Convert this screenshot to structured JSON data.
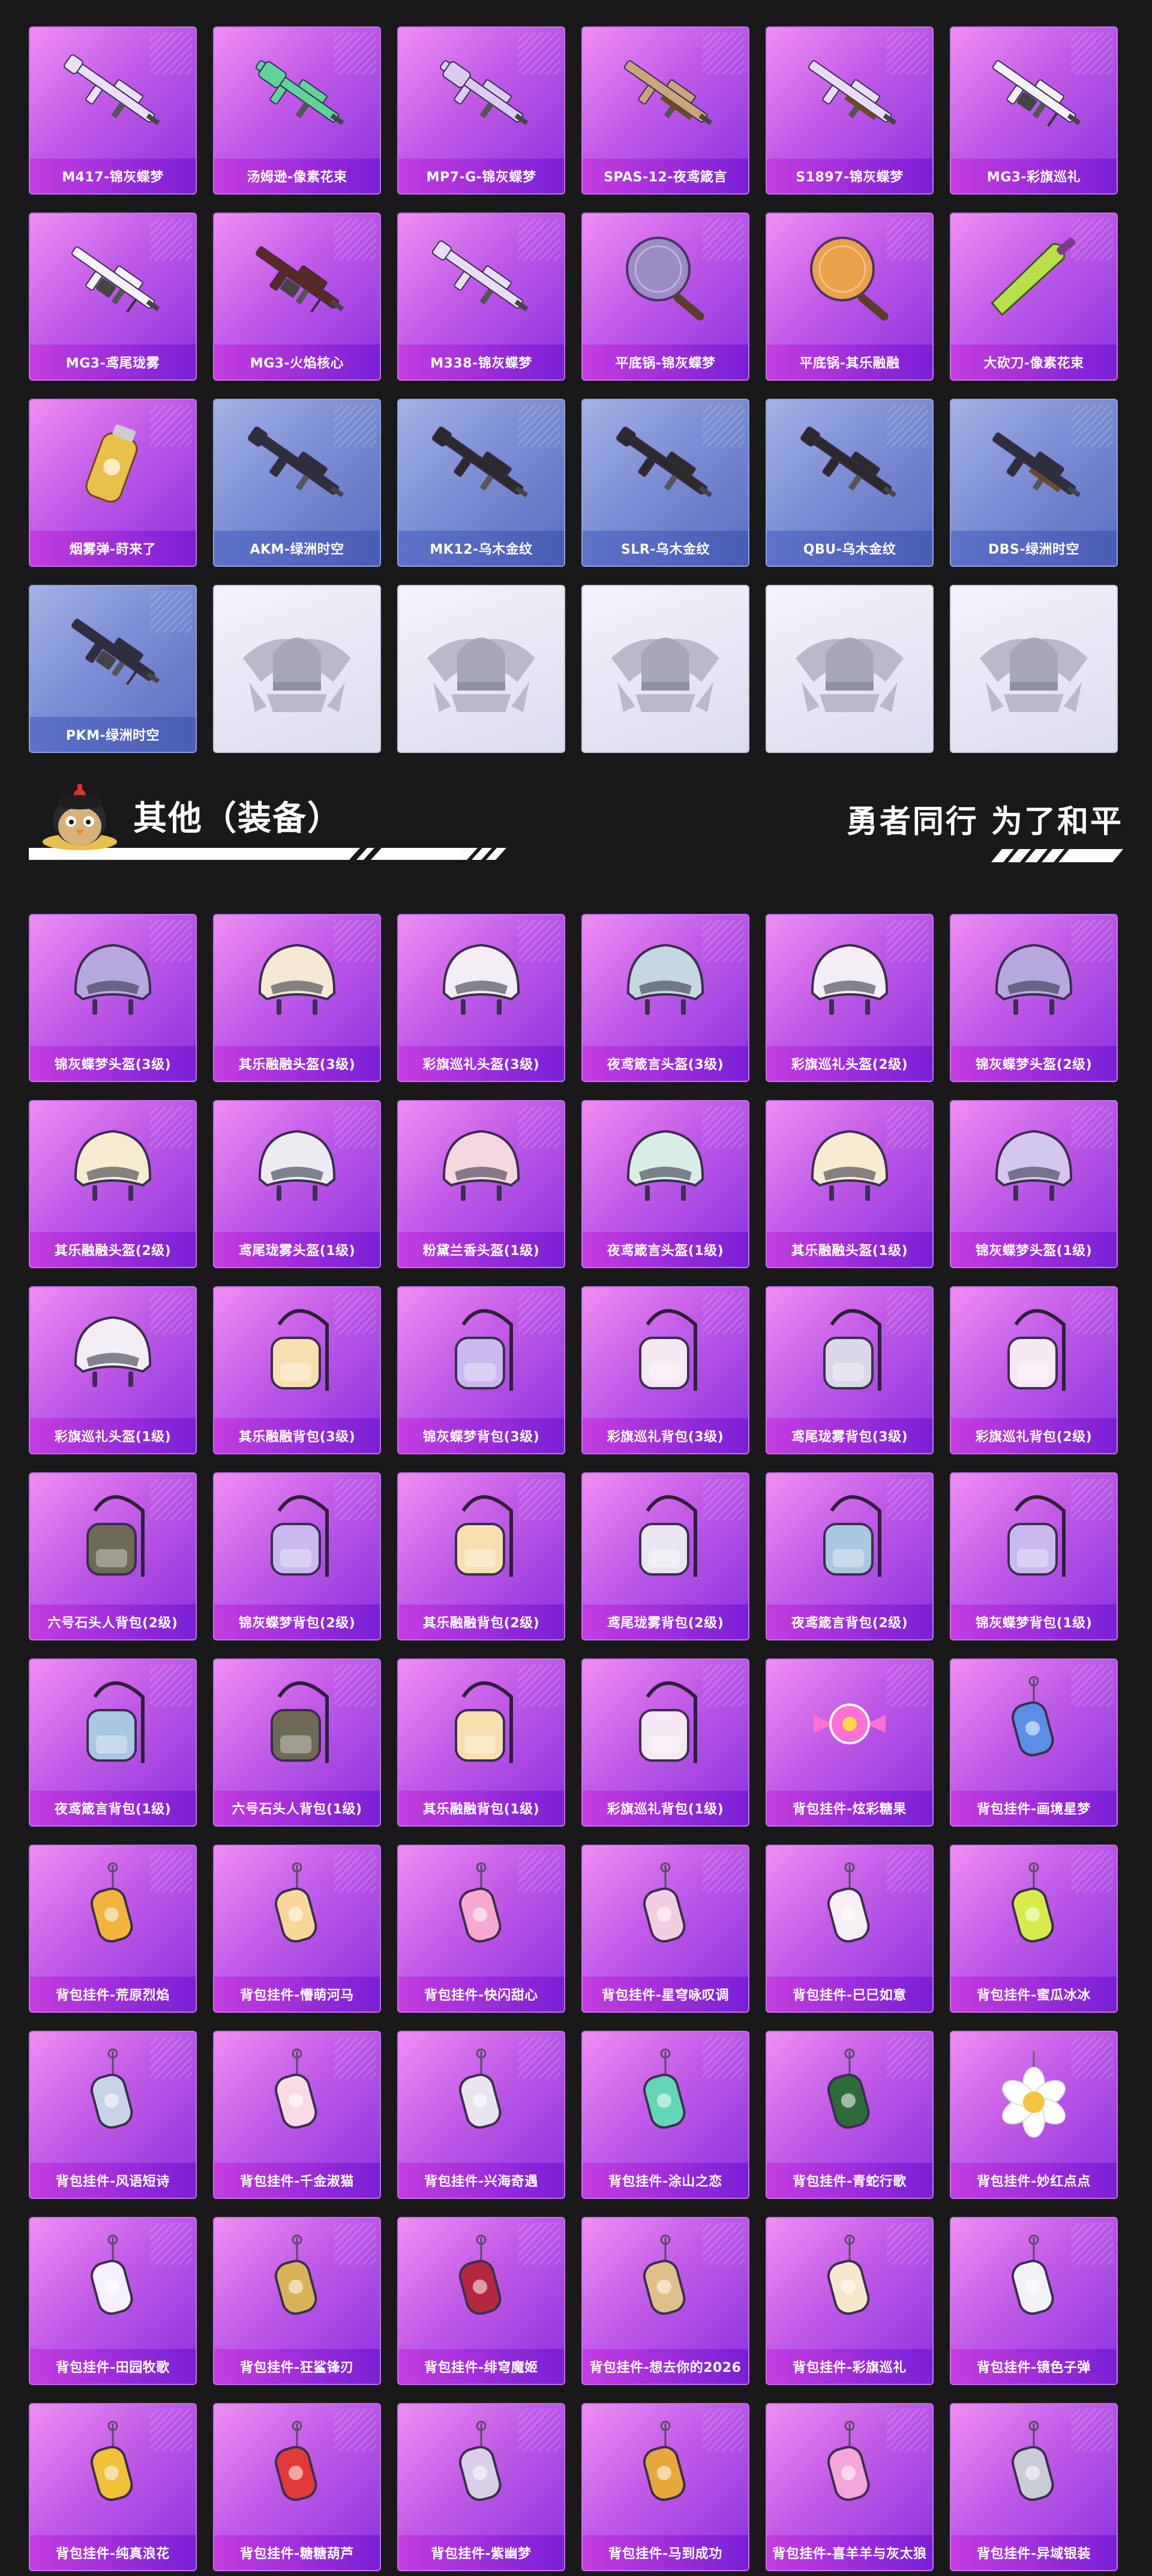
{
  "weapons": {
    "items": [
      {
        "label": "M417-锦灰蝶梦",
        "style": "purple",
        "icon": "rifle-icon",
        "color": "#e8e0f4"
      },
      {
        "label": "汤姆逊-像素花束",
        "style": "purple",
        "icon": "smg-icon",
        "color": "#5fd39a"
      },
      {
        "label": "MP7-G-锦灰蝶梦",
        "style": "purple",
        "icon": "smg-icon",
        "color": "#d8cdef"
      },
      {
        "label": "SPAS-12-夜鸢箴言",
        "style": "purple",
        "icon": "shotgun-icon",
        "color": "#c9a67a"
      },
      {
        "label": "S1897-锦灰蝶梦",
        "style": "purple",
        "icon": "shotgun-icon",
        "color": "#e6ddf2"
      },
      {
        "label": "MG3-彩旗巡礼",
        "style": "purple",
        "icon": "machinegun-icon",
        "color": "#f2f2f2"
      },
      {
        "label": "MG3-鸢尾珑雾",
        "style": "purple",
        "icon": "machinegun-icon",
        "color": "#f5f3f7"
      },
      {
        "label": "MG3-火焰核心",
        "style": "purple",
        "icon": "machinegun-icon",
        "color": "#5a2a22"
      },
      {
        "label": "M338-锦灰蝶梦",
        "style": "purple",
        "icon": "rifle-icon",
        "color": "#e6dff2"
      },
      {
        "label": "平底锅-锦灰蝶梦",
        "style": "purple",
        "icon": "pan-icon",
        "color": "#9a8cc4"
      },
      {
        "label": "平底锅-其乐融融",
        "style": "purple",
        "icon": "pan-icon",
        "color": "#e9a24a"
      },
      {
        "label": "大砍刀-像素花束",
        "style": "purple",
        "icon": "machete-icon",
        "color": "#b8e04a"
      },
      {
        "label": "烟雾弹-莳来了",
        "style": "purple",
        "icon": "grenade-icon",
        "color": "#e8c04a"
      },
      {
        "label": "AKM-绿洲时空",
        "style": "blue",
        "icon": "rifle-icon",
        "color": "#2d2f3a"
      },
      {
        "label": "MK12-乌木金纹",
        "style": "blue",
        "icon": "rifle-icon",
        "color": "#2b2a28"
      },
      {
        "label": "SLR-乌木金纹",
        "style": "blue",
        "icon": "rifle-icon",
        "color": "#2b2a28"
      },
      {
        "label": "QBU-乌木金纹",
        "style": "blue",
        "icon": "rifle-icon",
        "color": "#2b2a28"
      },
      {
        "label": "DBS-绿洲时空",
        "style": "blue",
        "icon": "shotgun-icon",
        "color": "#2d2f3a"
      },
      {
        "label": "PKM-绿洲时空",
        "style": "blue",
        "icon": "machinegun-icon",
        "color": "#2d2f3a"
      },
      {
        "label": "",
        "style": "empty",
        "icon": "pubg-emblem-icon",
        "color": "#b9b9c9"
      },
      {
        "label": "",
        "style": "empty",
        "icon": "pubg-emblem-icon",
        "color": "#b9b9c9"
      },
      {
        "label": "",
        "style": "empty",
        "icon": "pubg-emblem-icon",
        "color": "#b9b9c9"
      },
      {
        "label": "",
        "style": "empty",
        "icon": "pubg-emblem-icon",
        "color": "#b9b9c9"
      },
      {
        "label": "",
        "style": "empty",
        "icon": "pubg-emblem-icon",
        "color": "#b9b9c9"
      }
    ]
  },
  "section": {
    "title": "其他（装备）",
    "slogan": "勇者同行 为了和平",
    "mascot_icon": "chicken-mascot-icon"
  },
  "equipment": {
    "items": [
      {
        "label": "锦灰蝶梦头盔(3级)",
        "icon": "helmet-icon",
        "color": "#b7a8e0"
      },
      {
        "label": "其乐融融头盔(3级)",
        "icon": "helmet-icon",
        "color": "#f4ead3"
      },
      {
        "label": "彩旗巡礼头盔(3级)",
        "icon": "helmet-icon",
        "color": "#f3eef5"
      },
      {
        "label": "夜鸢箴言头盔(3级)",
        "icon": "helmet-icon",
        "color": "#c7d7e0"
      },
      {
        "label": "彩旗巡礼头盔(2级)",
        "icon": "helmet-icon",
        "color": "#f3eef5"
      },
      {
        "label": "锦灰蝶梦头盔(2级)",
        "icon": "helmet-icon",
        "color": "#b7a8e0"
      },
      {
        "label": "其乐融融头盔(2级)",
        "icon": "helmet-icon",
        "color": "#f6ecd2"
      },
      {
        "label": "鸢尾珑雾头盔(1级)",
        "icon": "helmet-icon",
        "color": "#ecebf2"
      },
      {
        "label": "粉黛兰香头盔(1级)",
        "icon": "helmet-icon",
        "color": "#f3d9df"
      },
      {
        "label": "夜鸢箴言头盔(1级)",
        "icon": "helmet-icon",
        "color": "#d9eee4"
      },
      {
        "label": "其乐融融头盔(1级)",
        "icon": "helmet-icon",
        "color": "#f6ecd2"
      },
      {
        "label": "锦灰蝶梦头盔(1级)",
        "icon": "helmet-icon",
        "color": "#d4c7ee"
      },
      {
        "label": "彩旗巡礼头盔(1级)",
        "icon": "helmet-icon",
        "color": "#f3eef5"
      },
      {
        "label": "其乐融融背包(3级)",
        "icon": "backpack-icon",
        "color": "#f6e0b0"
      },
      {
        "label": "锦灰蝶梦背包(3级)",
        "icon": "backpack-icon",
        "color": "#c9b9ef"
      },
      {
        "label": "彩旗巡礼背包(3级)",
        "icon": "backpack-icon",
        "color": "#f4e8f2"
      },
      {
        "label": "鸢尾珑雾背包(3级)",
        "icon": "backpack-icon",
        "color": "#dad7e6"
      },
      {
        "label": "彩旗巡礼背包(2级)",
        "icon": "backpack-icon",
        "color": "#f4e8f2"
      },
      {
        "label": "六号石头人背包(2级)",
        "icon": "backpack-icon",
        "color": "#6d6b55"
      },
      {
        "label": "锦灰蝶梦背包(2级)",
        "icon": "backpack-icon",
        "color": "#c9b9ef"
      },
      {
        "label": "其乐融融背包(2级)",
        "icon": "backpack-icon",
        "color": "#f6e0b0"
      },
      {
        "label": "鸢尾珑雾背包(2级)",
        "icon": "backpack-icon",
        "color": "#e8e6f0"
      },
      {
        "label": "夜鸢箴言背包(2级)",
        "icon": "backpack-icon",
        "color": "#a9c8e0"
      },
      {
        "label": "锦灰蝶梦背包(1级)",
        "icon": "backpack-icon",
        "color": "#c9b9ef"
      },
      {
        "label": "夜鸢箴言背包(1级)",
        "icon": "backpack-icon",
        "color": "#a9c8e0"
      },
      {
        "label": "六号石头人背包(1级)",
        "icon": "backpack-icon",
        "color": "#6d6b55"
      },
      {
        "label": "其乐融融背包(1级)",
        "icon": "backpack-icon",
        "color": "#f6e0b0"
      },
      {
        "label": "彩旗巡礼背包(1级)",
        "icon": "backpack-icon",
        "color": "#f4e8f2"
      },
      {
        "label": "背包挂件-炫彩糖果",
        "icon": "candy-icon",
        "color": "#ff6fd6"
      },
      {
        "label": "背包挂件-画境星梦",
        "icon": "charm-wand-icon",
        "color": "#5b8ee6"
      },
      {
        "label": "背包挂件-荒原烈焰",
        "icon": "sun-charm-icon",
        "color": "#f0b53a"
      },
      {
        "label": "背包挂件-懵萌河马",
        "icon": "charm-icon",
        "color": "#f7d79a"
      },
      {
        "label": "背包挂件-快闪甜心",
        "icon": "donut-charm-icon",
        "color": "#f7a8d0"
      },
      {
        "label": "背包挂件-星穹咏叹调",
        "icon": "charm-icon",
        "color": "#f1cfe2"
      },
      {
        "label": "背包挂件-巳巳如意",
        "icon": "fox-charm-icon",
        "color": "#f6f0f4"
      },
      {
        "label": "背包挂件-蜜瓜冰冰",
        "icon": "popsicle-charm-icon",
        "color": "#d6ec4a"
      },
      {
        "label": "背包挂件-风语短诗",
        "icon": "bag-charm-icon",
        "color": "#c9d3e6"
      },
      {
        "label": "背包挂件-千金淑猫",
        "icon": "cat-charm-icon",
        "color": "#f7dbe6"
      },
      {
        "label": "背包挂件-兴海奇遇",
        "icon": "tag-charm-icon",
        "color": "#e9e5ef"
      },
      {
        "label": "背包挂件-涂山之恋",
        "icon": "fan-charm-icon",
        "color": "#62d6b6"
      },
      {
        "label": "背包挂件-青蛇行歌",
        "icon": "snake-charm-icon",
        "color": "#2f6b3a"
      },
      {
        "label": "背包挂件-妙红点点",
        "icon": "flower-charm-icon",
        "color": "#ffffff"
      },
      {
        "label": "背包挂件-田园牧歌",
        "icon": "card-charm-icon",
        "color": "#f5f0ff"
      },
      {
        "label": "背包挂件-狂鲨锋刃",
        "icon": "blade-charm-icon",
        "color": "#d9b35a"
      },
      {
        "label": "背包挂件-绯穹魔姬",
        "icon": "wand-charm-icon",
        "color": "#b3283f"
      },
      {
        "label": "背包挂件-想去你的2026",
        "icon": "scroll-charm-icon",
        "color": "#e0c08a"
      },
      {
        "label": "背包挂件-彩旗巡礼",
        "icon": "icecream-charm-icon",
        "color": "#f5e8cc"
      },
      {
        "label": "背包挂件-镜色子弹",
        "icon": "bullet-charm-icon",
        "color": "#f2f2f6"
      },
      {
        "label": "背包挂件-纯真浪花",
        "icon": "key-charm-icon",
        "color": "#f0c23a"
      },
      {
        "label": "背包挂件-糖糖葫芦",
        "icon": "candied-haws-charm-icon",
        "color": "#e23a3a"
      },
      {
        "label": "背包挂件-紫幽梦",
        "icon": "bell-charm-icon",
        "color": "#d8d0e6"
      },
      {
        "label": "背包挂件-马到成功",
        "icon": "horse-charm-icon",
        "color": "#e6a83a"
      },
      {
        "label": "背包挂件-喜羊羊与灰太狼",
        "icon": "bow-charm-icon",
        "color": "#f4a6d8"
      },
      {
        "label": "背包挂件-异域银装",
        "icon": "wing-charm-icon",
        "color": "#c9cbd6"
      }
    ]
  }
}
